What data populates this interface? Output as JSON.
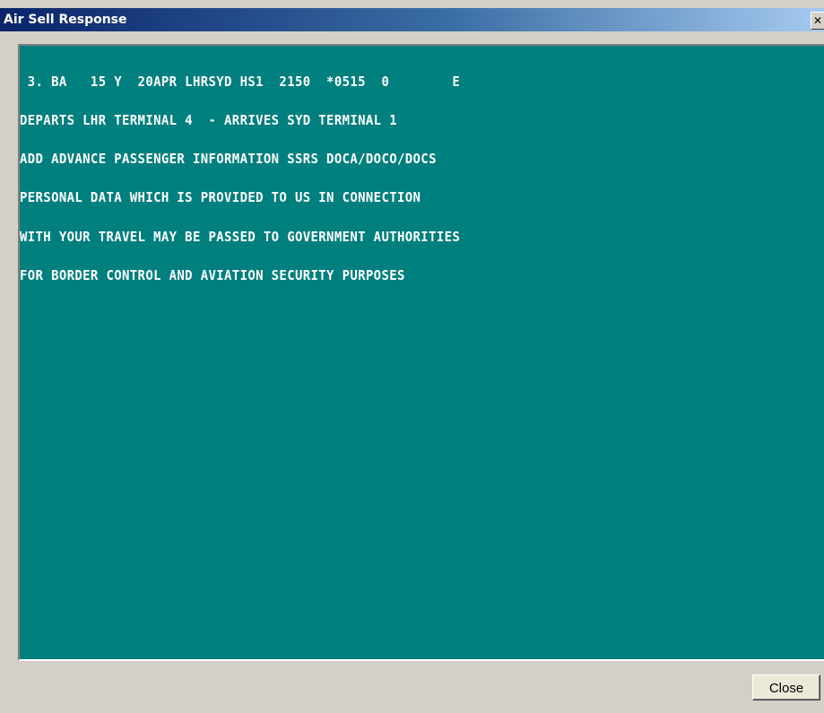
{
  "window": {
    "title": "Air Sell Response",
    "close_glyph": "✕"
  },
  "terminal": {
    "lines": [
      " 3. BA   15 Y  20APR LHRSYD HS1  2150  *0515  0        E",
      "DEPARTS LHR TERMINAL 4  - ARRIVES SYD TERMINAL 1",
      "ADD ADVANCE PASSENGER INFORMATION SSRS DOCA/DOCO/DOCS",
      "PERSONAL DATA WHICH IS PROVIDED TO US IN CONNECTION",
      "WITH YOUR TRAVEL MAY BE PASSED TO GOVERNMENT AUTHORITIES",
      "FOR BORDER CONTROL AND AVIATION SECURITY PURPOSES"
    ]
  },
  "footer": {
    "close_label": "Close"
  },
  "colors": {
    "terminal_background": "#007f7f",
    "terminal_text": "#ffffff",
    "titlebar_start": "#0a246a",
    "titlebar_end": "#a6caf0",
    "window_background": "#d4d0c8"
  },
  "icons": {
    "title_close": "close-icon"
  }
}
